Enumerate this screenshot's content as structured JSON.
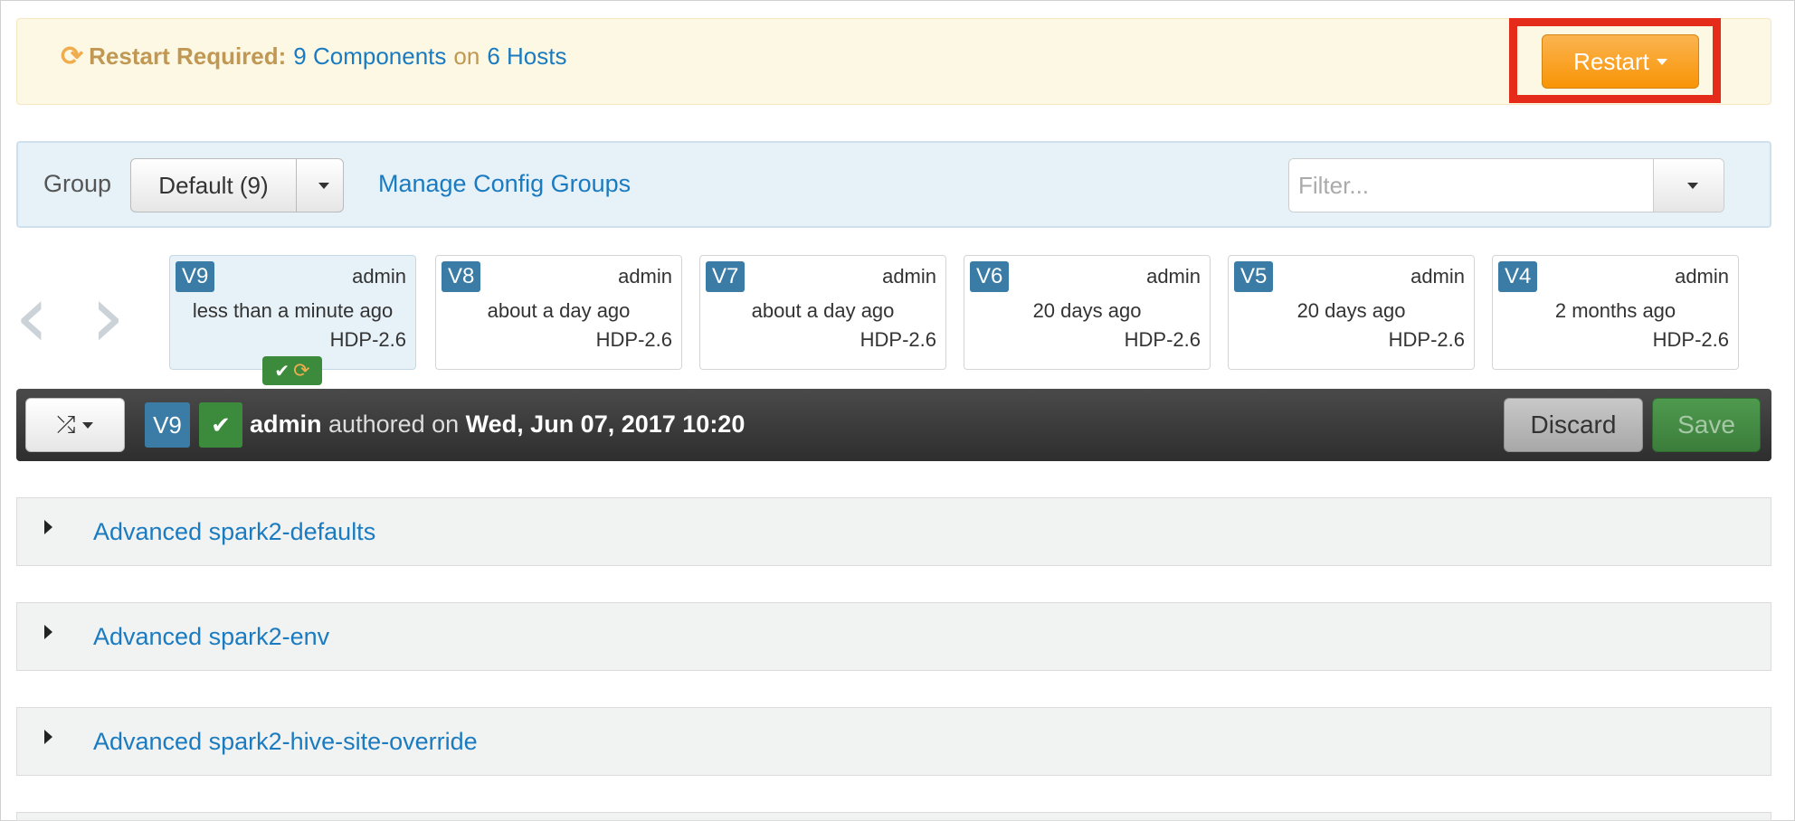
{
  "restart_banner": {
    "label": "Restart Required:",
    "components_link": "9 Components",
    "on_text": "on",
    "hosts_link": "6 Hosts",
    "restart_button": "Restart",
    "refresh_icon": "refresh-icon",
    "accent": "#f89406"
  },
  "group_bar": {
    "label": "Group",
    "selected_group": "Default (9)",
    "manage_link": "Manage Config Groups",
    "filter_placeholder": "Filter...",
    "filter_value": ""
  },
  "version_nav": {
    "prev_icon": "chevron-left-icon",
    "next_icon": "chevron-right-icon"
  },
  "versions": [
    {
      "label": "V9",
      "author": "admin",
      "time": "less than a minute ago",
      "stack": "HDP-2.6",
      "current": true
    },
    {
      "label": "V8",
      "author": "admin",
      "time": "about a day ago",
      "stack": "HDP-2.6"
    },
    {
      "label": "V7",
      "author": "admin",
      "time": "about a day ago",
      "stack": "HDP-2.6"
    },
    {
      "label": "V6",
      "author": "admin",
      "time": "20 days ago",
      "stack": "HDP-2.6"
    },
    {
      "label": "V5",
      "author": "admin",
      "time": "20 days ago",
      "stack": "HDP-2.6"
    },
    {
      "label": "V4",
      "author": "admin",
      "time": "2 months ago",
      "stack": "HDP-2.6"
    }
  ],
  "current_bar": {
    "version": "V9",
    "author": "admin",
    "authored_text": "authored on",
    "date": "Wed, Jun 07, 2017 10:20",
    "discard_button": "Discard",
    "save_button": "Save"
  },
  "sections": [
    {
      "title": "Advanced spark2-defaults"
    },
    {
      "title": "Advanced spark2-env"
    },
    {
      "title": "Advanced spark2-hive-site-override"
    }
  ]
}
